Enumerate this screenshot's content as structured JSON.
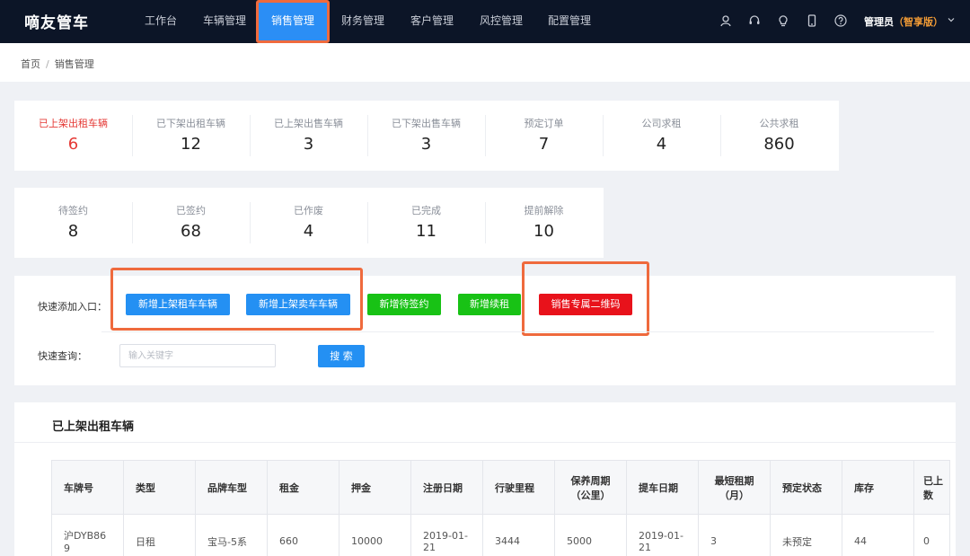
{
  "app": {
    "logo": "嘀友管车"
  },
  "nav": [
    {
      "label": "工作台",
      "active": false
    },
    {
      "label": "车辆管理",
      "active": false
    },
    {
      "label": "销售管理",
      "active": true
    },
    {
      "label": "财务管理",
      "active": false
    },
    {
      "label": "客户管理",
      "active": false
    },
    {
      "label": "风控管理",
      "active": false
    },
    {
      "label": "配置管理",
      "active": false
    }
  ],
  "user": {
    "name": "管理员",
    "edition": "（智享版）"
  },
  "breadcrumb": {
    "home": "首页",
    "separator": "/",
    "current": "销售管理"
  },
  "stats_row1": [
    {
      "label": "已上架出租车辆",
      "value": "6"
    },
    {
      "label": "已下架出租车辆",
      "value": "12"
    },
    {
      "label": "已上架出售车辆",
      "value": "3"
    },
    {
      "label": "已下架出售车辆",
      "value": "3"
    },
    {
      "label": "预定订单",
      "value": "7"
    },
    {
      "label": "公司求租",
      "value": "4"
    },
    {
      "label": "公共求租",
      "value": "860"
    }
  ],
  "stats_row2": [
    {
      "label": "待签约",
      "value": "8"
    },
    {
      "label": "已签约",
      "value": "68"
    },
    {
      "label": "已作废",
      "value": "4"
    },
    {
      "label": "已完成",
      "value": "11"
    },
    {
      "label": "提前解除",
      "value": "10"
    }
  ],
  "quick": {
    "add_label": "快速添加入口：",
    "buttons": [
      {
        "label": "新增上架租车车辆",
        "color": "#2490f3"
      },
      {
        "label": "新增上架卖车车辆",
        "color": "#2490f3"
      },
      {
        "label": "新增待签约",
        "color": "#18c215"
      },
      {
        "label": "新增续租",
        "color": "#18c215"
      },
      {
        "label": "销售专属二维码",
        "color": "#e8121b"
      }
    ],
    "search_label": "快速查询：",
    "search_placeholder": "输入关键字",
    "search_button": "搜 索"
  },
  "table": {
    "title": "已上架出租车辆",
    "headers": [
      "车牌号",
      "类型",
      "品牌车型",
      "租金",
      "押金",
      "注册日期",
      "行驶里程",
      "保养周期\n（公里）",
      "提车日期",
      "最短租期\n（月）",
      "预定状态",
      "库存",
      "已上\n数"
    ],
    "rows": [
      [
        "沪DYB86\n9",
        "日租",
        "宝马-5系",
        "660",
        "10000",
        "2019-01-\n21",
        "3444",
        "5000",
        "2019-01-\n21",
        "3",
        "未预定",
        "44",
        "0"
      ]
    ]
  },
  "colors": {
    "nav_bg": "#0c1527",
    "accent": "#2b8ef5",
    "highlight": "#ef6a3d",
    "alert": "#e53935"
  }
}
